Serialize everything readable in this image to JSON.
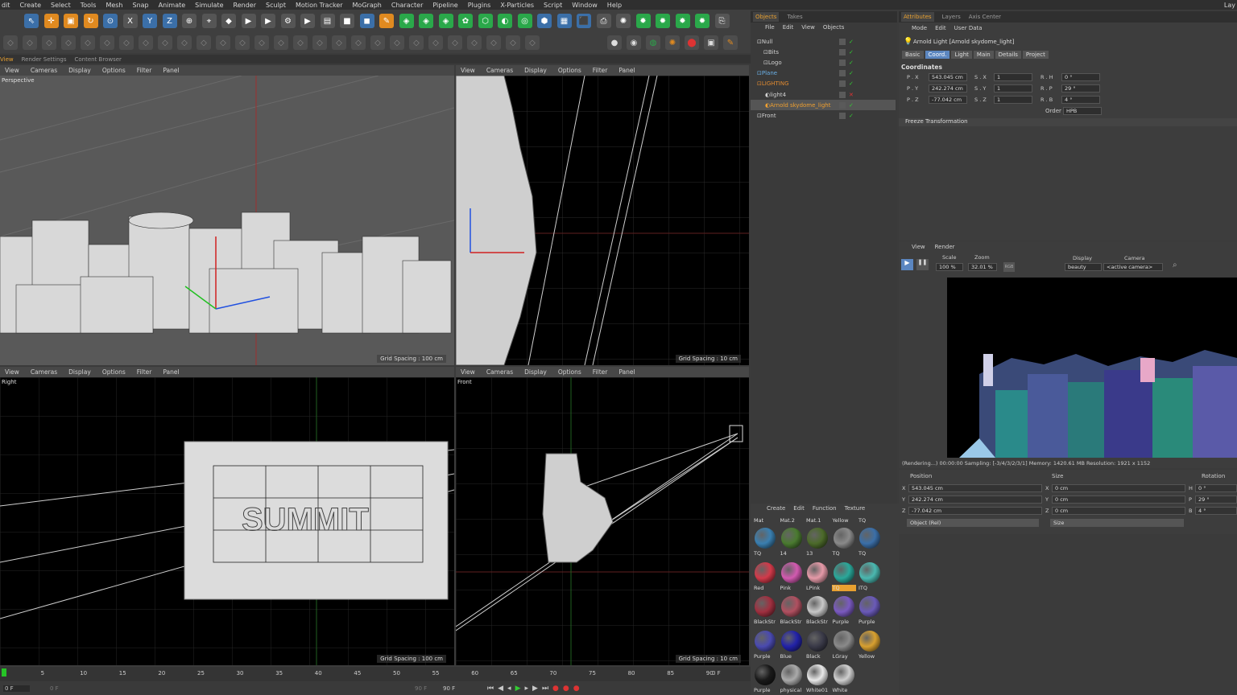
{
  "menu": [
    "dit",
    "Create",
    "Select",
    "Tools",
    "Mesh",
    "Snap",
    "Animate",
    "Simulate",
    "Render",
    "Sculpt",
    "Motion Tracker",
    "MoGraph",
    "Character",
    "Pipeline",
    "Plugins",
    "X-Particles",
    "Script",
    "Window",
    "Help"
  ],
  "layout_label": "Lay",
  "left_tabs": [
    "View",
    "Render Settings",
    "Content Browser"
  ],
  "viewport_menu": [
    "View",
    "Cameras",
    "Display",
    "Options",
    "Filter",
    "Panel"
  ],
  "viewports": {
    "tl": {
      "label": "Perspective",
      "grid": "Grid Spacing : 100 cm"
    },
    "tr": {
      "label": "",
      "grid": "Grid Spacing : 10 cm"
    },
    "bl": {
      "label": "Right",
      "grid": "Grid Spacing : 100 cm"
    },
    "br": {
      "label": "Front",
      "grid": "Grid Spacing : 10 cm"
    }
  },
  "objects_tabs": [
    "Objects",
    "Takes"
  ],
  "objects_menu": [
    "File",
    "Edit",
    "View",
    "Objects"
  ],
  "objects_tree": [
    "Null",
    "Bits",
    "Logo",
    "Plane",
    "LIGHTING",
    "light4",
    "Arnold skydome_light",
    "Front"
  ],
  "attributes_tabs": [
    "Attributes",
    "Layers",
    "Axis Center"
  ],
  "attr_menu": [
    "Mode",
    "Edit",
    "User Data"
  ],
  "attr_title": "Arnold Light [Arnold skydome_light]",
  "attr_subtabs": [
    "Basic",
    "Coord.",
    "Light",
    "Main",
    "Details",
    "Project"
  ],
  "coordinates": {
    "heading": "Coordinates",
    "pos": [
      {
        "l": "P . X",
        "v": "543.045 cm"
      },
      {
        "l": "P . Y",
        "v": "242.274 cm"
      },
      {
        "l": "P . Z",
        "v": "-77.042 cm"
      }
    ],
    "scale": [
      {
        "l": "S . X",
        "v": "1"
      },
      {
        "l": "S . Y",
        "v": "1"
      },
      {
        "l": "S . Z",
        "v": "1"
      }
    ],
    "rot": [
      {
        "l": "R . H",
        "v": "0 °"
      },
      {
        "l": "R . P",
        "v": "29 °"
      },
      {
        "l": "R . B",
        "v": "4 °"
      }
    ],
    "order_label": "Order",
    "order_value": "HPB",
    "freeze": "Freeze Transformation"
  },
  "render_view": {
    "menu": [
      "View",
      "Render"
    ],
    "scale_label": "Scale",
    "scale_value": "100 %",
    "zoom_label": "Zoom",
    "zoom_value": "32.01 %",
    "display_label": "Display",
    "display_value": "beauty",
    "camera_label": "Camera",
    "camera_value": "<active camera>",
    "rgb": "RGB",
    "status": "(Rendering...) 00:00:00  Sampling: [-3/4/3/2/3/1]  Memory: 1420.61 MB  Resolution: 1921 x 1152"
  },
  "transform": {
    "headers": [
      "Position",
      "Size",
      "Rotation"
    ],
    "rows": [
      {
        "a": "X",
        "p": "543.045 cm",
        "b": "X",
        "s": "0 cm",
        "c": "H",
        "r": "0 °"
      },
      {
        "a": "Y",
        "p": "242.274 cm",
        "b": "Y",
        "s": "0 cm",
        "c": "P",
        "r": "29 °"
      },
      {
        "a": "Z",
        "p": "-77.042 cm",
        "b": "Z",
        "s": "0 cm",
        "c": "B",
        "r": "4 °"
      }
    ],
    "mode": "Object (Rel)",
    "size_mode": "Size"
  },
  "material_menu": [
    "Create",
    "Edit",
    "Function",
    "Texture"
  ],
  "materials": [
    {
      "name": "TQ",
      "color": "#3a7fb0"
    },
    {
      "name": "14",
      "color": "#4a7a30"
    },
    {
      "name": "13",
      "color": "#4c6a2a"
    },
    {
      "name": "TQ",
      "color": "#8a8a8a"
    },
    {
      "name": "TQ",
      "color": "#3b6fa8"
    },
    {
      "name": "Red",
      "color": "#d23a4a"
    },
    {
      "name": "Pink",
      "color": "#d25ab0"
    },
    {
      "name": "LPink",
      "color": "#e59aa8"
    },
    {
      "name": "TQ",
      "color": "#2aa89a"
    },
    {
      "name": "ITQ",
      "color": "#4ab8b0"
    },
    {
      "name": "BlackStr",
      "color": "#a03040"
    },
    {
      "name": "BlackStr",
      "color": "#b05060"
    },
    {
      "name": "BlackStr",
      "color": "#c8c8c8"
    },
    {
      "name": "Purple",
      "color": "#7a5ac0"
    },
    {
      "name": "Purple",
      "color": "#6a5ab8"
    },
    {
      "name": "Purple",
      "color": "#4a4ab0"
    },
    {
      "name": "Blue",
      "color": "#2222a8"
    },
    {
      "name": "Black",
      "color": "#3a3a48"
    },
    {
      "name": "LGray",
      "color": "#8a8a8a"
    },
    {
      "name": "Yellow",
      "color": "#d8a030"
    },
    {
      "name": "Purple",
      "color": "#1a1a1a"
    },
    {
      "name": "physical",
      "color": "#aaaaaa"
    },
    {
      "name": "White01",
      "color": "#e8e8e8"
    },
    {
      "name": "White",
      "color": "#cfcfcf"
    }
  ],
  "mat_header": [
    "Mat",
    "Mat.2",
    "Mat.1",
    "Yellow",
    "TQ"
  ],
  "timeline": {
    "ticks": [
      "0",
      "5",
      "10",
      "15",
      "20",
      "25",
      "30",
      "35",
      "40",
      "45",
      "50",
      "55",
      "60",
      "65",
      "70",
      "75",
      "80",
      "85",
      "90"
    ],
    "frame_end": "0 F",
    "current": "0 F",
    "start": "0 F",
    "end": "90 F",
    "end2": "90 F"
  }
}
